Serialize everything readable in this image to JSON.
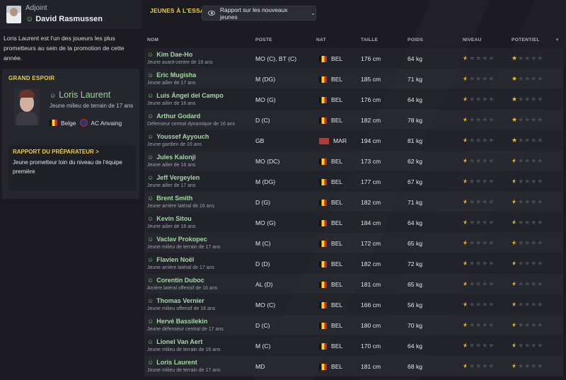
{
  "staff": {
    "role": "Adjoint",
    "name": "David Rasmussen"
  },
  "intro_text": "Loris Laurent est l'un des joueurs les plus prometteurs au sein de la promotion de cette année.",
  "highlight": {
    "header": "GRAND ESPOIR",
    "name": "Loris Laurent",
    "description": "Jeune milieu de terrain de 17 ans",
    "nationality": "Belge",
    "club": "AC Anvaing",
    "report_header": "RAPPORT DU PRÉPARATEUR",
    "report_arrow": ">",
    "report_text": "Jeune prometteur loin du niveau de l'équipe première"
  },
  "section_title": "JEUNES À L'ESSAI",
  "report_button": "Rapport sur les nouveaux jeunes",
  "columns": {
    "name": "NOM",
    "position": "POSTE",
    "nat": "NAT",
    "height": "TAILLE",
    "weight": "POIDS",
    "level": "NIVEAU",
    "potential": "POTENTIEL",
    "sort": "▾"
  },
  "colors": {
    "accent": "#f2d22a",
    "player_name": "#a6d7a6",
    "star": "#f0c420"
  },
  "players": [
    {
      "name": "Kim Dae-Ho",
      "desc": "Jeune avant-centre de 16 ans",
      "position": "MO (C), BT (C)",
      "nat": "BEL",
      "height": "176 cm",
      "weight": "64 kg",
      "level": 0.5,
      "potential": 1
    },
    {
      "name": "Eric Mugisha",
      "desc": "Jeune ailier de 17 ans",
      "position": "M (DG)",
      "nat": "BEL",
      "height": "185 cm",
      "weight": "71 kg",
      "level": 0.5,
      "potential": 1
    },
    {
      "name": "Luis Ángel del Campo",
      "desc": "Jeune ailier de 16 ans",
      "position": "MO (G)",
      "nat": "BEL",
      "height": "176 cm",
      "weight": "64 kg",
      "level": 0.5,
      "potential": 1
    },
    {
      "name": "Arthur Godard",
      "desc": "Défenseur central dynamique de 16 ans",
      "position": "D (C)",
      "nat": "BEL",
      "height": "182 cm",
      "weight": "78 kg",
      "level": 0.5,
      "potential": 1
    },
    {
      "name": "Youssef Ayyouch",
      "desc": "Jeune gardien de 16 ans",
      "position": "GB",
      "nat": "MAR",
      "height": "194 cm",
      "weight": "81 kg",
      "level": 0.5,
      "potential": 1
    },
    {
      "name": "Jules Kalonji",
      "desc": "Jeune ailier de 16 ans",
      "position": "MO (DC)",
      "nat": "BEL",
      "height": "173 cm",
      "weight": "62 kg",
      "level": 0.5,
      "potential": 0.5
    },
    {
      "name": "Jeff Vergeylen",
      "desc": "Jeune ailier de 17 ans",
      "position": "M (DG)",
      "nat": "BEL",
      "height": "177 cm",
      "weight": "67 kg",
      "level": 0.5,
      "potential": 0.5
    },
    {
      "name": "Brent Smith",
      "desc": "Jeune arrière latéral de 16 ans",
      "position": "D (G)",
      "nat": "BEL",
      "height": "182 cm",
      "weight": "71 kg",
      "level": 0.5,
      "potential": 0.5
    },
    {
      "name": "Kevin Sitou",
      "desc": "Jeune ailier de 16 ans",
      "position": "MO (G)",
      "nat": "BEL",
      "height": "184 cm",
      "weight": "64 kg",
      "level": 0.5,
      "potential": 0.5
    },
    {
      "name": "Vaclav Prokopec",
      "desc": "Jeune milieu de terrain de 17 ans",
      "position": "M (C)",
      "nat": "BEL",
      "height": "172 cm",
      "weight": "65 kg",
      "level": 0.5,
      "potential": 0.5
    },
    {
      "name": "Flavien Noël",
      "desc": "Jeune arrière latéral de 17 ans",
      "position": "D (D)",
      "nat": "BEL",
      "height": "182 cm",
      "weight": "72 kg",
      "level": 0.5,
      "potential": 0.5
    },
    {
      "name": "Corentin Duboc",
      "desc": "Arrière latéral offensif de 16 ans",
      "position": "AL (D)",
      "nat": "BEL",
      "height": "181 cm",
      "weight": "65 kg",
      "level": 0.5,
      "potential": 0.5
    },
    {
      "name": "Thomas Vernier",
      "desc": "Jeune milieu offensif de 16 ans",
      "position": "MO (C)",
      "nat": "BEL",
      "height": "166 cm",
      "weight": "56 kg",
      "level": 0.5,
      "potential": 0.5
    },
    {
      "name": "Hervé Bassilekin",
      "desc": "Jeune défenseur central de 17 ans",
      "position": "D (C)",
      "nat": "BEL",
      "height": "180 cm",
      "weight": "70 kg",
      "level": 0.5,
      "potential": 0.5
    },
    {
      "name": "Lionel Van Aert",
      "desc": "Jeune milieu de terrain de 16 ans",
      "position": "M (C)",
      "nat": "BEL",
      "height": "170 cm",
      "weight": "64 kg",
      "level": 0.5,
      "potential": 0.5
    },
    {
      "name": "Loris Laurent",
      "desc": "Jeune milieu de terrain de 17 ans",
      "position": "MD",
      "nat": "BEL",
      "height": "181 cm",
      "weight": "68 kg",
      "level": 0.5,
      "potential": 0.5
    }
  ]
}
